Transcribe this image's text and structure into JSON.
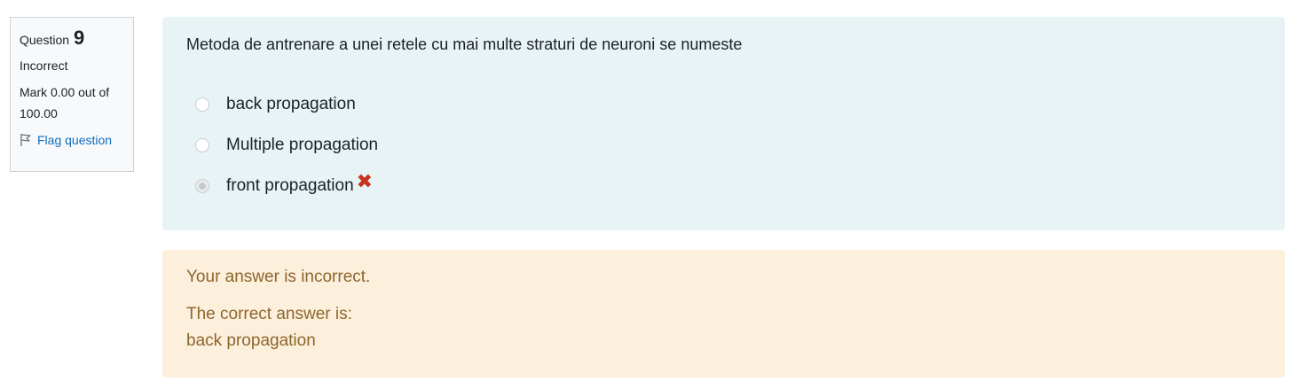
{
  "info": {
    "question_label": "Question",
    "question_number": "9",
    "state": "Incorrect",
    "grade": "Mark 0.00 out of 100.00",
    "flag_label": "Flag question"
  },
  "formulation": {
    "question_text": "Metoda de antrenare a unei retele cu mai multe straturi de neuroni se numeste",
    "options": [
      {
        "label": "back propagation",
        "selected": false
      },
      {
        "label": "Multiple propagation",
        "selected": false
      },
      {
        "label": "front propagation",
        "selected": true,
        "marked": "incorrect"
      }
    ],
    "incorrect_mark": "✖"
  },
  "feedback": {
    "general": "Your answer is incorrect.",
    "right_answer_prefix": "The correct answer is:",
    "right_answer": "back propagation"
  },
  "colors": {
    "info_bg": "#f8f9fa",
    "formulation_bg": "#e7f3f5",
    "feedback_bg": "#fcefdc",
    "feedback_text": "#8e662e",
    "link": "#0f6cbf",
    "incorrect": "#ca3120"
  }
}
